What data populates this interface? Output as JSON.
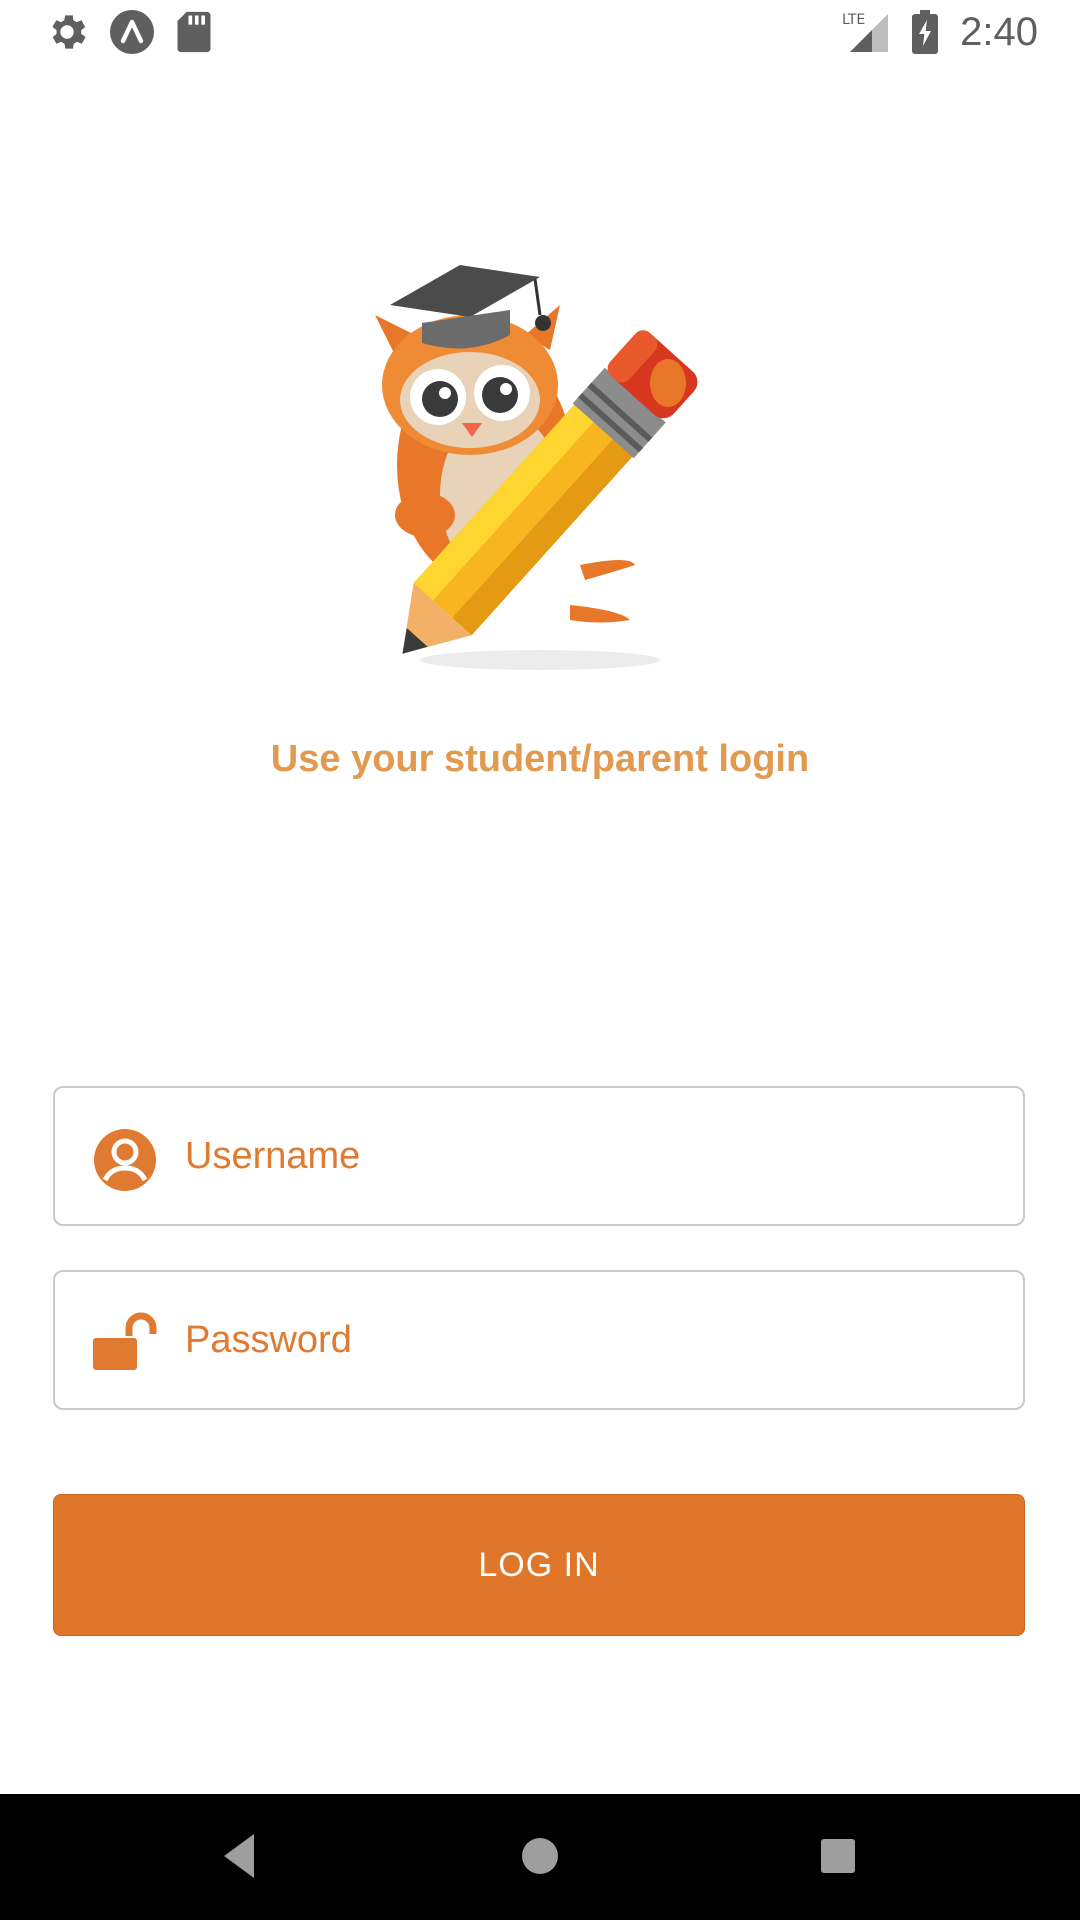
{
  "status_bar": {
    "time": "2:40",
    "network": "LTE",
    "left_icons": [
      "gear-icon",
      "app-circle-icon",
      "sd-card-icon"
    ],
    "right_icons": [
      "signal-icon",
      "battery-charging-icon"
    ]
  },
  "logo": {
    "icon": "owl-pencil-logo"
  },
  "subtitle": "Use your student/parent login",
  "form": {
    "username": {
      "placeholder": "Username",
      "icon": "user-circle-icon"
    },
    "password": {
      "placeholder": "Password",
      "icon": "unlock-icon"
    },
    "login_label": "LOG IN"
  },
  "navigation": {
    "buttons": [
      "back-icon",
      "home-icon",
      "recents-icon"
    ]
  },
  "colors": {
    "accent": "#df7629",
    "subtitle": "#e29950",
    "field_border": "#c9c9c9",
    "nav_bar": "#000000"
  }
}
